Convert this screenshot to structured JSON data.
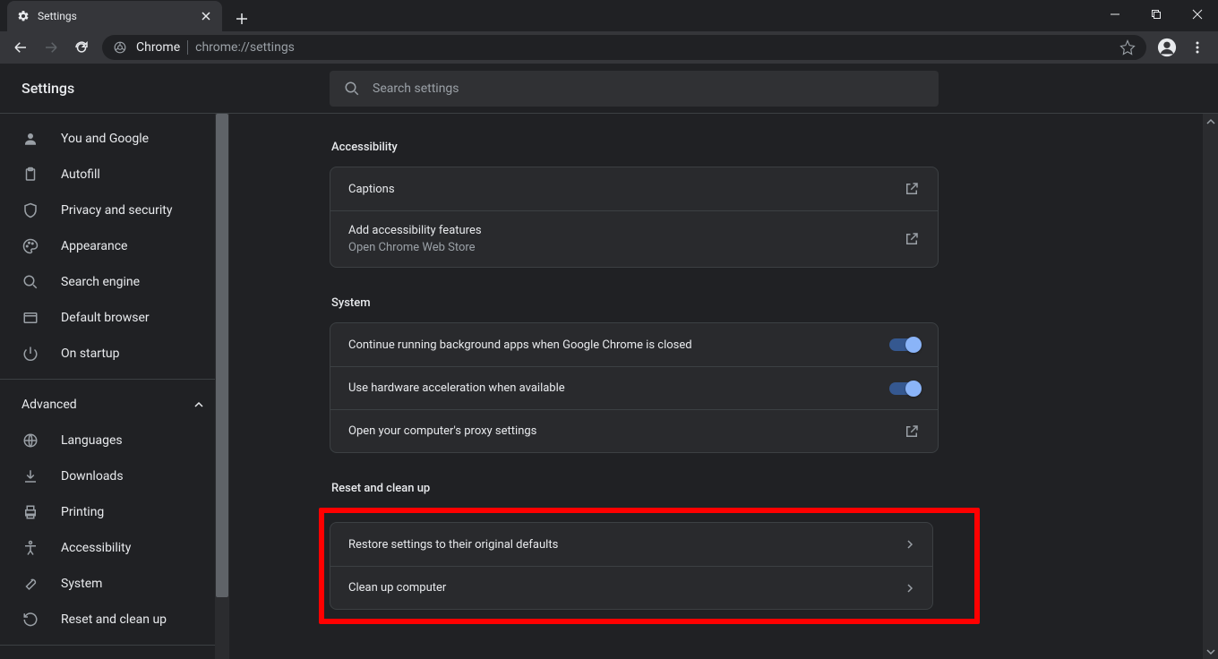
{
  "tab": {
    "title": "Settings"
  },
  "omnibox": {
    "origin": "Chrome",
    "path": "chrome://settings"
  },
  "header": {
    "title": "Settings",
    "search_placeholder": "Search settings"
  },
  "sidebar": {
    "items": [
      {
        "label": "You and Google"
      },
      {
        "label": "Autofill"
      },
      {
        "label": "Privacy and security"
      },
      {
        "label": "Appearance"
      },
      {
        "label": "Search engine"
      },
      {
        "label": "Default browser"
      },
      {
        "label": "On startup"
      }
    ],
    "advanced_label": "Advanced",
    "advanced_items": [
      {
        "label": "Languages"
      },
      {
        "label": "Downloads"
      },
      {
        "label": "Printing"
      },
      {
        "label": "Accessibility"
      },
      {
        "label": "System"
      },
      {
        "label": "Reset and clean up"
      }
    ]
  },
  "sections": {
    "accessibility": {
      "title": "Accessibility",
      "rows": [
        {
          "label": "Captions"
        },
        {
          "label": "Add accessibility features",
          "sublabel": "Open Chrome Web Store"
        }
      ]
    },
    "system": {
      "title": "System",
      "rows": [
        {
          "label": "Continue running background apps when Google Chrome is closed"
        },
        {
          "label": "Use hardware acceleration when available"
        },
        {
          "label": "Open your computer's proxy settings"
        }
      ]
    },
    "reset": {
      "title": "Reset and clean up",
      "rows": [
        {
          "label": "Restore settings to their original defaults"
        },
        {
          "label": "Clean up computer"
        }
      ]
    }
  }
}
